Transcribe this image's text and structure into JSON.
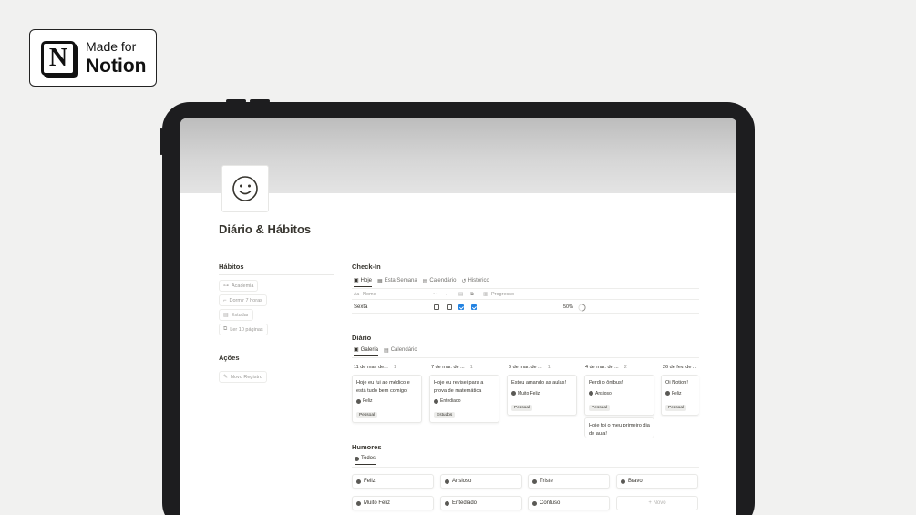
{
  "badge": {
    "line1": "Made for",
    "line2": "Notion",
    "logo_letter": "N"
  },
  "page": {
    "title": "Diário & Hábitos",
    "icon": "smiley-icon"
  },
  "habits": {
    "heading": "Hábitos",
    "items": [
      {
        "icon": "dumbbell-icon",
        "glyph": "⊶",
        "label": "Academia"
      },
      {
        "icon": "bed-icon",
        "glyph": "⌐",
        "label": "Dormir 7 horas"
      },
      {
        "icon": "document-icon",
        "glyph": "▤",
        "label": "Estudar"
      },
      {
        "icon": "book-icon",
        "glyph": "⧉",
        "label": "Ler 10 páginas"
      }
    ]
  },
  "actions": {
    "heading": "Ações",
    "items": [
      {
        "icon": "edit-icon",
        "glyph": "✎",
        "label": "Novo Registro"
      }
    ]
  },
  "checkin": {
    "heading": "Check-In",
    "tabs": [
      {
        "icon": "window-icon",
        "glyph": "▣",
        "label": "Hoje"
      },
      {
        "icon": "calendar-icon",
        "glyph": "▦",
        "label": "Esta Semana"
      },
      {
        "icon": "calendar-icon",
        "glyph": "▤",
        "label": "Calendário"
      },
      {
        "icon": "history-icon",
        "glyph": "↺",
        "label": "Histórico"
      }
    ],
    "col_name_prefix": "Aa",
    "col_name": "Nome",
    "col_progress": "Progresso",
    "row": {
      "name": "Sexta",
      "checks": [
        false,
        false,
        true,
        true
      ],
      "progress": "50%",
      "progress_value": 0.5
    }
  },
  "diario": {
    "heading": "Diário",
    "tabs": [
      {
        "icon": "gallery-icon",
        "glyph": "▣",
        "label": "Galeria"
      },
      {
        "icon": "calendar-icon",
        "glyph": "▤",
        "label": "Calendário"
      }
    ],
    "columns": [
      {
        "date": "11 de mar. de...",
        "count": "1",
        "cards": [
          {
            "text": "Hoje eu fui ao médico e está tudo bem comigo!",
            "mood": "Feliz",
            "tag": "Pessoal"
          }
        ]
      },
      {
        "date": "7 de mar. de ...",
        "count": "1",
        "cards": [
          {
            "text": "Hoje eu revisei para a prova de matemática",
            "mood": "Entediado",
            "tag": "Estudos"
          }
        ]
      },
      {
        "date": "6 de mar. de ...",
        "count": "1",
        "cards": [
          {
            "text": "Estou amando as aulas!",
            "mood": "Muito Feliz",
            "tag": "Pessoal"
          }
        ]
      },
      {
        "date": "4 de mar. de ...",
        "count": "2",
        "cards": [
          {
            "text": "Perdi o ônibus!",
            "mood": "Ansioso",
            "tag": "Pessoal"
          },
          {
            "text": "Hoje foi o meu primeiro dia de aula!",
            "mood": "",
            "tag": ""
          }
        ]
      },
      {
        "date": "26 de fev. de ...",
        "count": "",
        "cards": [
          {
            "text": "Oi Notion!",
            "mood": "Feliz",
            "tag": "Pessoal"
          }
        ]
      }
    ]
  },
  "humores": {
    "heading": "Humores",
    "tabs": [
      {
        "icon": "mood-icon",
        "label": "Todos"
      }
    ],
    "items": [
      "Feliz",
      "Ansioso",
      "Triste",
      "Bravo",
      "Muito Feliz",
      "Entediado",
      "Confuso"
    ],
    "new_label": "+ Novo"
  }
}
